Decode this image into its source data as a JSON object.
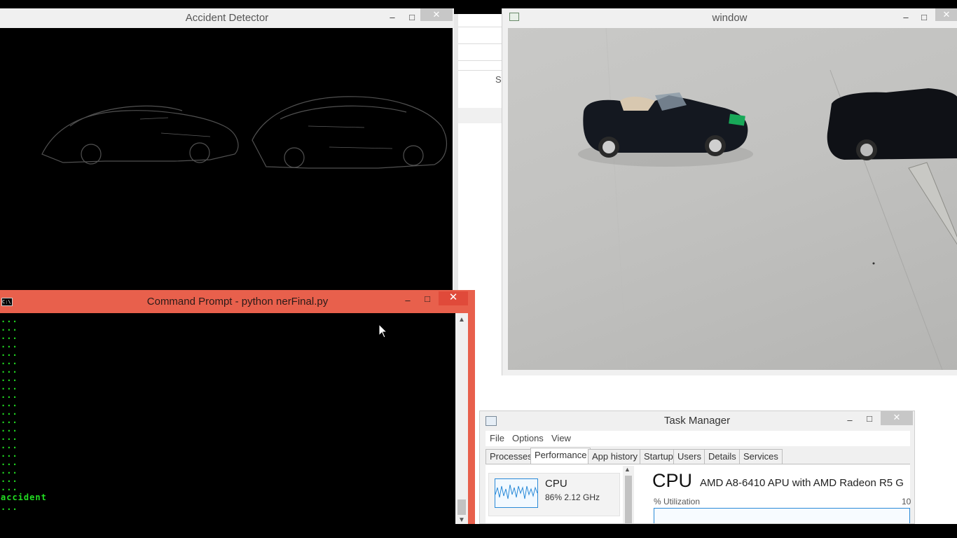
{
  "accident_window": {
    "title": "Accident Detector",
    "controls": {
      "minimize": "–",
      "maximize": "□",
      "close": "✕"
    }
  },
  "camera_window": {
    "title": "window",
    "controls": {
      "minimize": "–",
      "maximize": "□",
      "close": "✕"
    }
  },
  "mid_panel": {
    "partial_text": "Si"
  },
  "command_prompt": {
    "title": "Command Prompt - python  nerFinal.py",
    "icon_text": "C:\\",
    "controls": {
      "minimize": "–",
      "maximize": "□",
      "close": "✕"
    },
    "lines": [
      "...",
      "...",
      "...",
      "...",
      "...",
      "...",
      "...",
      "...",
      "...",
      "...",
      "...",
      "...",
      "...",
      "...",
      "...",
      "...",
      "...",
      "...",
      "...",
      "...",
      "...",
      "accident",
      "..."
    ]
  },
  "task_manager": {
    "title": "Task Manager",
    "controls": {
      "minimize": "–",
      "maximize": "□",
      "close": "✕"
    },
    "menu": [
      "File",
      "Options",
      "View"
    ],
    "tabs": [
      "Processes",
      "Performance",
      "App history",
      "Startup",
      "Users",
      "Details",
      "Services"
    ],
    "active_tab": "Performance",
    "cpu_tile": {
      "label": "CPU",
      "value": "86%  2.12 GHz"
    },
    "cpu_heading": "CPU",
    "cpu_model": "AMD A8-6410 APU with AMD Radeon R5 G",
    "utilization_label": "% Utilization",
    "utilization_max": "10"
  },
  "icons": [
    "app-icon",
    "cmd-icon",
    "performance-icon",
    "mouse-cursor-icon",
    "scroll-up-icon",
    "scroll-down-icon"
  ]
}
